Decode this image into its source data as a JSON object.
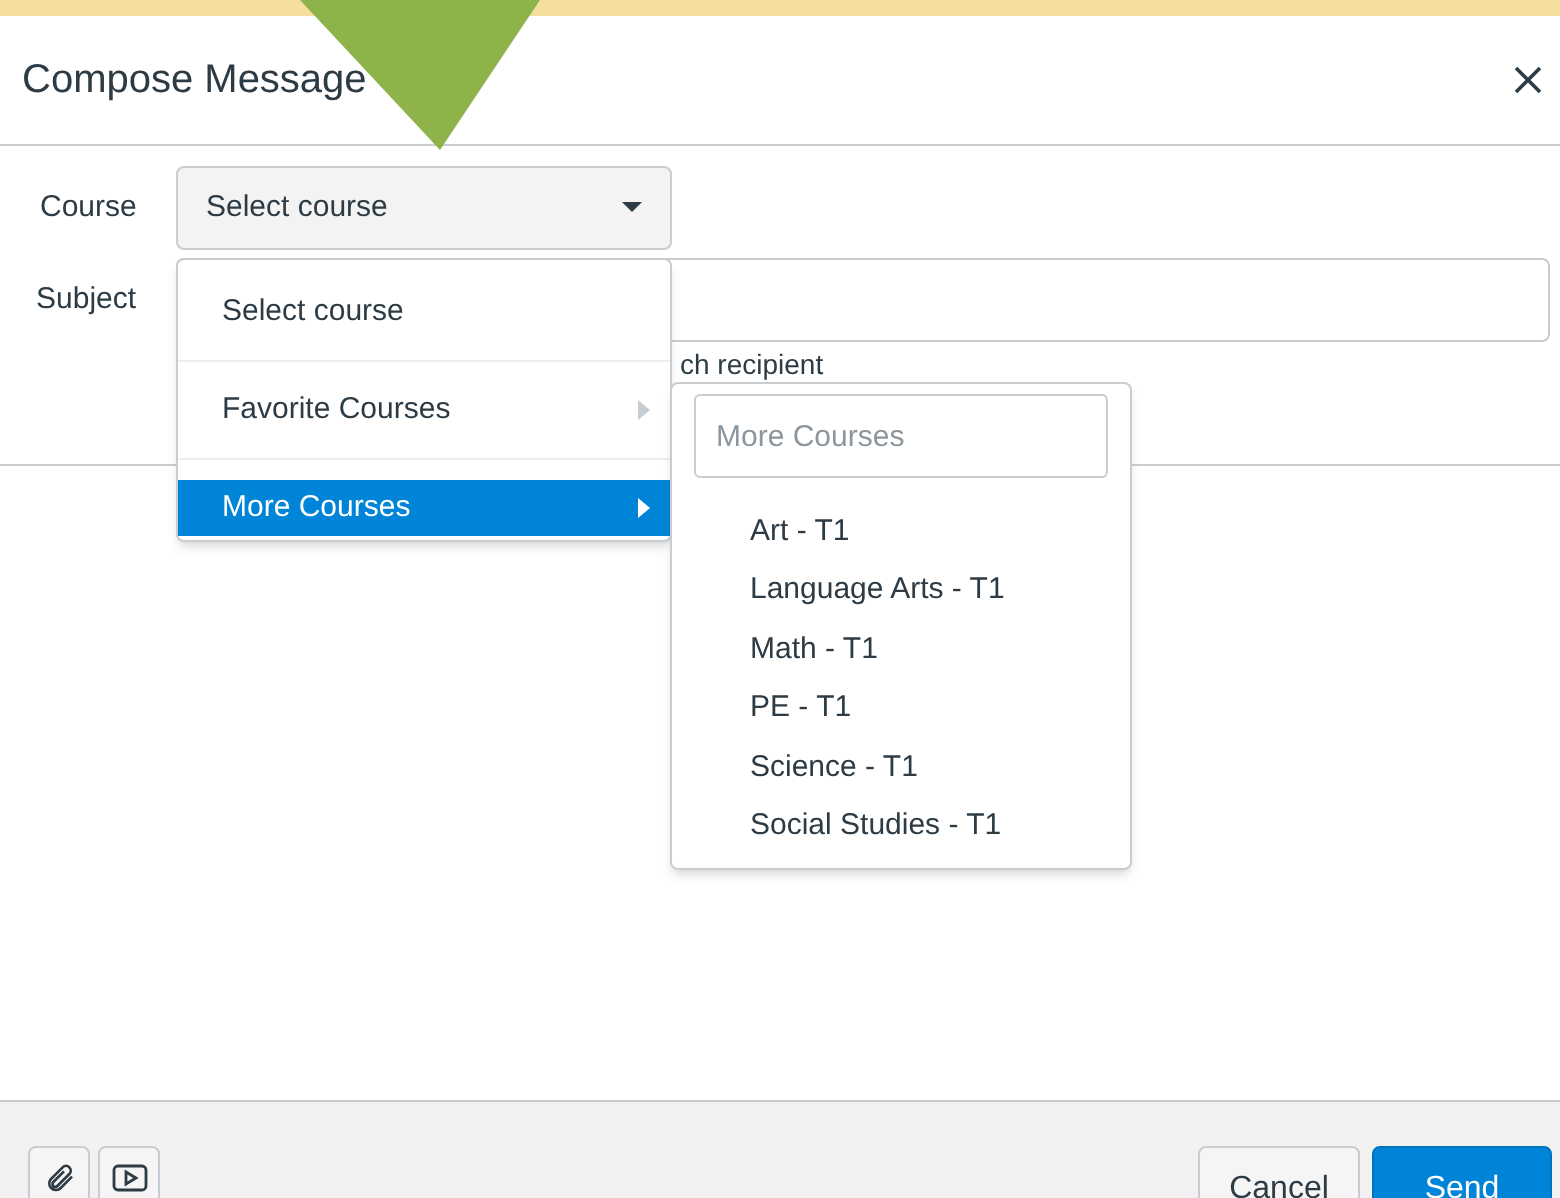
{
  "window": {
    "title": "Compose Message"
  },
  "form": {
    "course": {
      "label": "Course",
      "value": "Select course"
    },
    "subject": {
      "label": "Subject"
    },
    "option_text": "ch recipient"
  },
  "course_menu": {
    "items": [
      {
        "label": "Select course",
        "kind": "option",
        "selected": false
      },
      {
        "label": "Favorite Courses",
        "kind": "submenu",
        "selected": false
      },
      {
        "label": "More Courses",
        "kind": "submenu",
        "selected": true
      }
    ]
  },
  "submenu": {
    "search": {
      "placeholder": "More Courses"
    },
    "items": [
      {
        "label": "Art - T1"
      },
      {
        "label": "Language Arts - T1"
      },
      {
        "label": "Math - T1"
      },
      {
        "label": "PE - T1"
      },
      {
        "label": "Science - T1"
      },
      {
        "label": "Social Studies - T1"
      }
    ]
  },
  "footer": {
    "buttons": [
      {
        "label": "Cancel",
        "kind": "secondary"
      },
      {
        "label": "Send",
        "kind": "primary"
      }
    ]
  }
}
